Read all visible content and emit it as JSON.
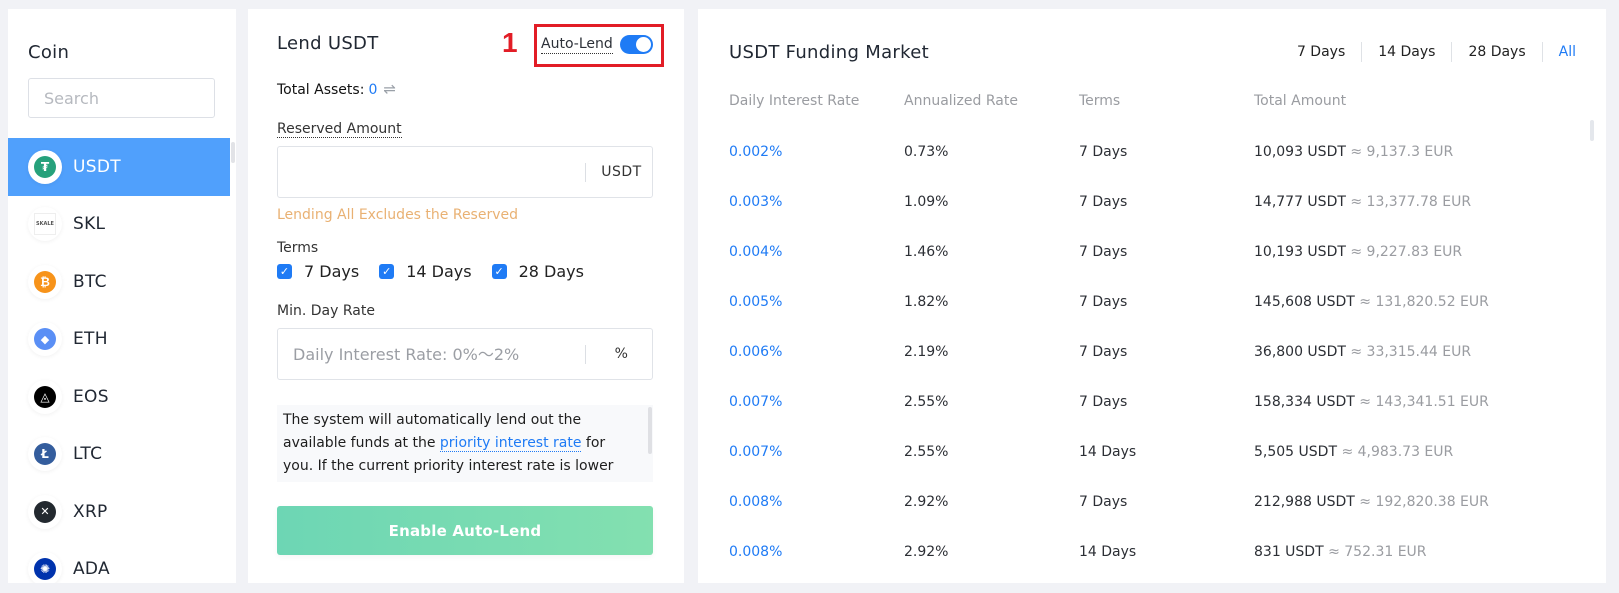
{
  "coin_panel": {
    "title": "Coin",
    "search_placeholder": "Search",
    "coins": [
      {
        "symbol": "USDT",
        "icon": "tether-icon",
        "color": "#26a17b",
        "glyph": "₮",
        "active": true
      },
      {
        "symbol": "SKL",
        "icon": "skale-icon",
        "color": "#ffffff",
        "glyph": "SKALE",
        "active": false
      },
      {
        "symbol": "BTC",
        "icon": "bitcoin-icon",
        "color": "#f7931a",
        "glyph": "₿",
        "active": false
      },
      {
        "symbol": "ETH",
        "icon": "ethereum-icon",
        "color": "#5a8ff5",
        "glyph": "◆",
        "active": false
      },
      {
        "symbol": "EOS",
        "icon": "eos-icon",
        "color": "#000000",
        "glyph": "◬",
        "active": false
      },
      {
        "symbol": "LTC",
        "icon": "litecoin-icon",
        "color": "#345d9d",
        "glyph": "Ł",
        "active": false
      },
      {
        "symbol": "XRP",
        "icon": "xrp-icon",
        "color": "#23292f",
        "glyph": "✕",
        "active": false
      },
      {
        "symbol": "ADA",
        "icon": "cardano-icon",
        "color": "#0033ad",
        "glyph": "✺",
        "active": false
      }
    ]
  },
  "lend_panel": {
    "title": "Lend USDT",
    "annotation_number": "1",
    "auto_lend_label": "Auto-Lend",
    "auto_lend_enabled": true,
    "total_assets_label": "Total Assets:",
    "total_assets_value": "0",
    "swap_icon": "⇌",
    "reserved_label": "Reserved Amount",
    "reserved_value": "",
    "reserved_unit": "USDT",
    "reserved_hint": "Lending All Excludes the Reserved",
    "terms_label": "Terms",
    "terms": [
      {
        "label": "7 Days",
        "checked": true
      },
      {
        "label": "14 Days",
        "checked": true
      },
      {
        "label": "28 Days",
        "checked": true
      }
    ],
    "min_rate_label": "Min. Day Rate",
    "min_rate_placeholder": "Daily Interest Rate: 0%～2%",
    "min_rate_unit": "%",
    "info_text_before": "The system will automatically lend out the available funds at the ",
    "info_link": "priority interest rate",
    "info_text_after": " for you. If the current priority interest rate is lower",
    "enable_button": "Enable Auto-Lend"
  },
  "market_panel": {
    "title": "USDT Funding Market",
    "filters": [
      {
        "label": "7 Days",
        "active": false
      },
      {
        "label": "14 Days",
        "active": false
      },
      {
        "label": "28 Days",
        "active": false
      },
      {
        "label": "All",
        "active": true
      }
    ],
    "columns": [
      "Daily Interest Rate",
      "Annualized Rate",
      "Terms",
      "Total Amount"
    ],
    "rows": [
      {
        "daily": "0.002%",
        "annual": "0.73%",
        "terms": "7 Days",
        "amount": "10,093 USDT",
        "eur": "≈ 9,137.3 EUR"
      },
      {
        "daily": "0.003%",
        "annual": "1.09%",
        "terms": "7 Days",
        "amount": "14,777 USDT",
        "eur": "≈ 13,377.78 EUR"
      },
      {
        "daily": "0.004%",
        "annual": "1.46%",
        "terms": "7 Days",
        "amount": "10,193 USDT",
        "eur": "≈ 9,227.83 EUR"
      },
      {
        "daily": "0.005%",
        "annual": "1.82%",
        "terms": "7 Days",
        "amount": "145,608 USDT",
        "eur": "≈ 131,820.52 EUR"
      },
      {
        "daily": "0.006%",
        "annual": "2.19%",
        "terms": "7 Days",
        "amount": "36,800 USDT",
        "eur": "≈ 33,315.44 EUR"
      },
      {
        "daily": "0.007%",
        "annual": "2.55%",
        "terms": "7 Days",
        "amount": "158,334 USDT",
        "eur": "≈ 143,341.51 EUR"
      },
      {
        "daily": "0.007%",
        "annual": "2.55%",
        "terms": "14 Days",
        "amount": "5,505 USDT",
        "eur": "≈ 4,983.73 EUR"
      },
      {
        "daily": "0.008%",
        "annual": "2.92%",
        "terms": "7 Days",
        "amount": "212,988 USDT",
        "eur": "≈ 192,820.38 EUR"
      },
      {
        "daily": "0.008%",
        "annual": "2.92%",
        "terms": "14 Days",
        "amount": "831 USDT",
        "eur": "≈ 752.31 EUR"
      }
    ]
  },
  "colors": {
    "accent_blue": "#1f7bf5",
    "active_row": "#50a0fc",
    "hint_orange": "#e9b173",
    "annotation_red": "#e21d26",
    "button_green": "#74dab4"
  }
}
